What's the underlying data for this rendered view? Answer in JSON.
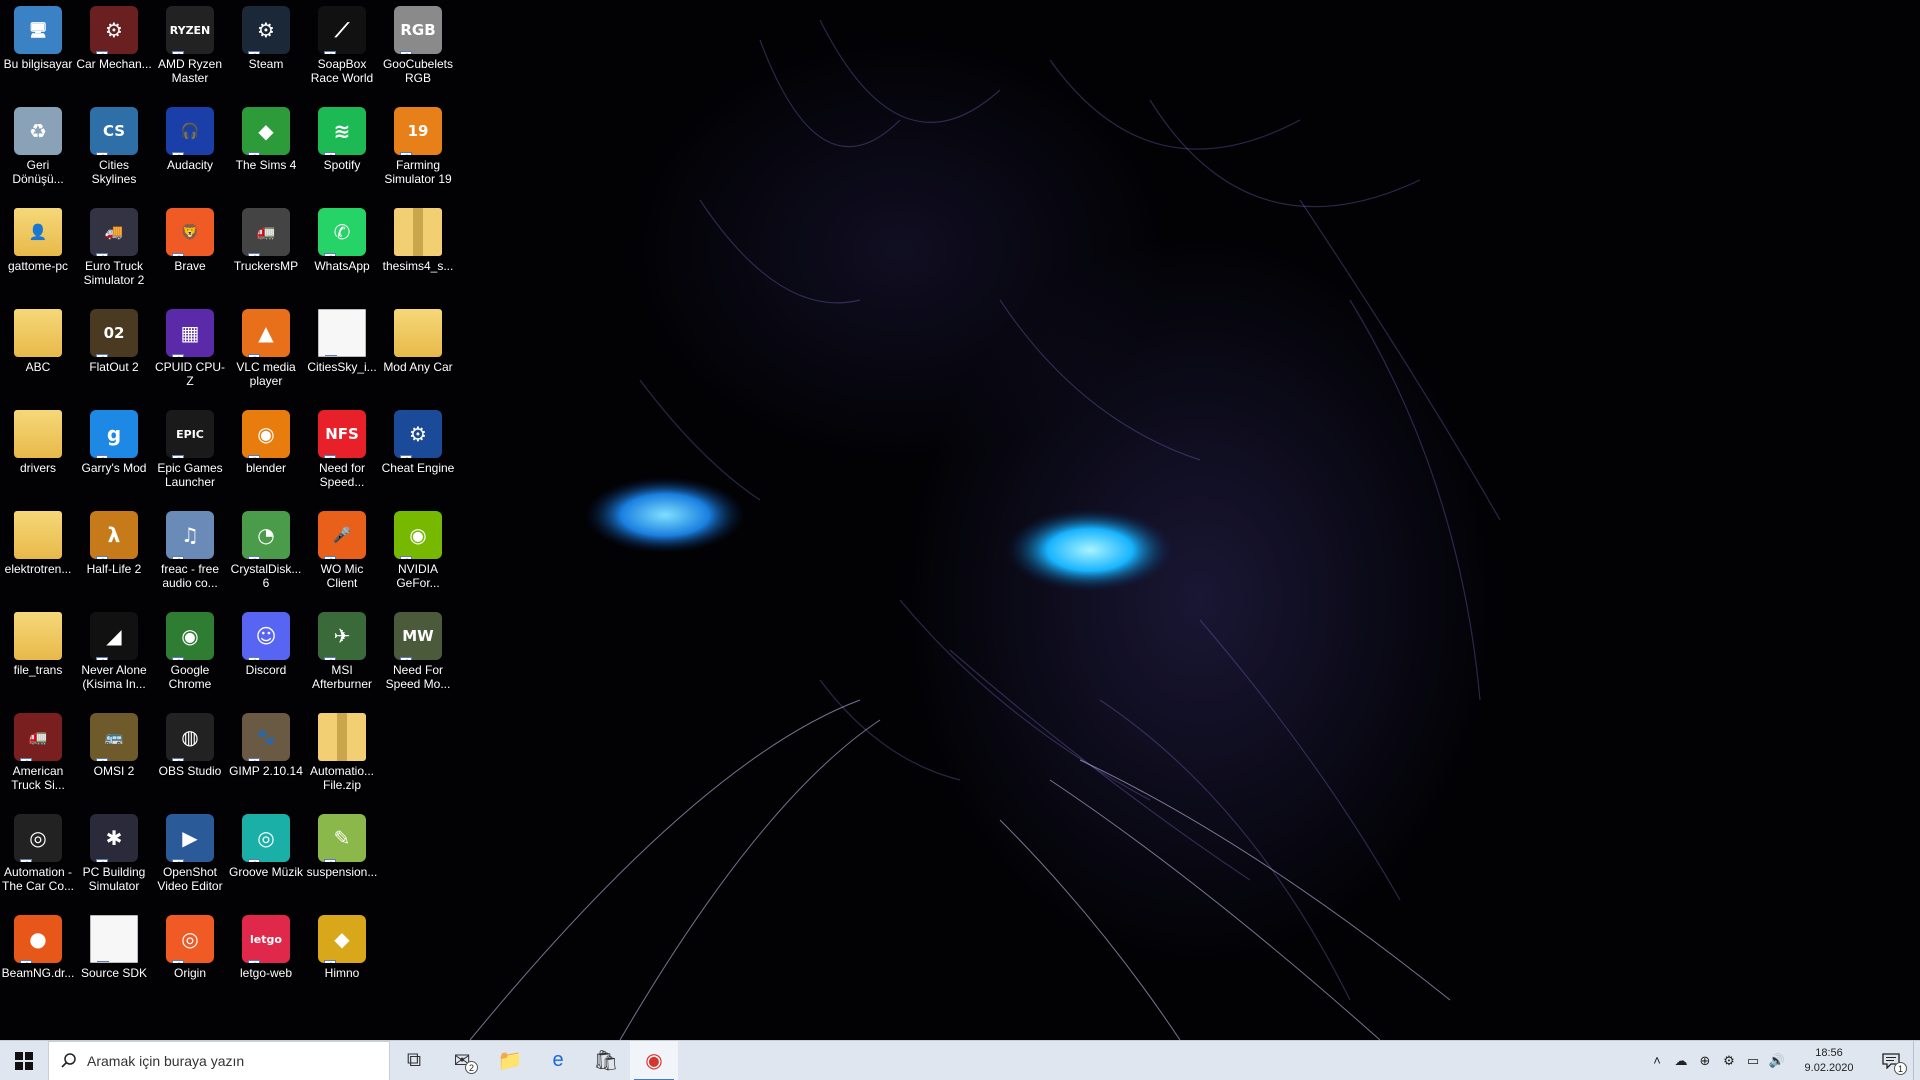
{
  "search": {
    "placeholder": "Aramak için buraya yazın"
  },
  "clock": {
    "time": "18:56",
    "date": "9.02.2020"
  },
  "mail_badge": "2",
  "notification_badge": "1",
  "desktop_icons": [
    {
      "label": "Bu bilgisayar",
      "icon": "computer-icon",
      "sym": "🖥",
      "bg": "#3b82c4"
    },
    {
      "label": "Geri Dönüşü...",
      "icon": "recycle-bin-icon",
      "sym": "♻",
      "bg": "#8aa2b8"
    },
    {
      "label": "gattome-pc",
      "icon": "user-folder-icon",
      "sym": "👤",
      "bg": "folder"
    },
    {
      "label": "ABC",
      "icon": "folder-icon",
      "sym": "",
      "bg": "folder"
    },
    {
      "label": "drivers",
      "icon": "folder-icon",
      "sym": "",
      "bg": "folder"
    },
    {
      "label": "elektrotren...",
      "icon": "folder-icon",
      "sym": "",
      "bg": "folder"
    },
    {
      "label": "file_trans",
      "icon": "folder-icon",
      "sym": "",
      "bg": "folder"
    },
    {
      "label": "American Truck Si...",
      "icon": "american-truck-icon",
      "sym": "🚛",
      "bg": "#7a1f1f"
    },
    {
      "label": "Automation - The Car Co...",
      "icon": "automation-icon",
      "sym": "◎",
      "bg": "#222"
    },
    {
      "label": "BeamNG.dr...",
      "icon": "beamng-icon",
      "sym": "●",
      "bg": "#e8571a"
    },
    {
      "label": "Car Mechan...",
      "icon": "car-mechanic-icon",
      "sym": "⚙",
      "bg": "#6a2020"
    },
    {
      "label": "Cities Skylines",
      "icon": "cities-skylines-icon",
      "sym": "CS",
      "bg": "#2f6fa8"
    },
    {
      "label": "Euro Truck Simulator 2",
      "icon": "euro-truck-icon",
      "sym": "🚚",
      "bg": "#334"
    },
    {
      "label": "FlatOut 2",
      "icon": "flatout-icon",
      "sym": "02",
      "bg": "#4a3a22"
    },
    {
      "label": "Garry's Mod",
      "icon": "garrys-mod-icon",
      "sym": "g",
      "bg": "#1e88e5"
    },
    {
      "label": "Half-Life 2",
      "icon": "half-life-icon",
      "sym": "λ",
      "bg": "#c77a1a"
    },
    {
      "label": "Never Alone (Kisima In...",
      "icon": "never-alone-icon",
      "sym": "◢",
      "bg": "#111"
    },
    {
      "label": "OMSI 2",
      "icon": "omsi-icon",
      "sym": "🚌",
      "bg": "#6e5a2a"
    },
    {
      "label": "PC Building Simulator",
      "icon": "pc-building-icon",
      "sym": "✱",
      "bg": "#2a2a3a"
    },
    {
      "label": "Source SDK",
      "icon": "document-icon",
      "sym": "",
      "bg": "doc"
    },
    {
      "label": "AMD Ryzen Master",
      "icon": "amd-ryzen-icon",
      "sym": "RYZEN",
      "bg": "#222"
    },
    {
      "label": "Audacity",
      "icon": "audacity-icon",
      "sym": "🎧",
      "bg": "#1a3fa8"
    },
    {
      "label": "Brave",
      "icon": "brave-icon",
      "sym": "🦁",
      "bg": "#f05a24"
    },
    {
      "label": "CPUID CPU-Z",
      "icon": "cpuz-icon",
      "sym": "▦",
      "bg": "#5a2aa8"
    },
    {
      "label": "Epic Games Launcher",
      "icon": "epic-games-icon",
      "sym": "EPIC",
      "bg": "#1a1a1a"
    },
    {
      "label": "freac - free audio co...",
      "icon": "freac-icon",
      "sym": "♫",
      "bg": "#6a8ab8"
    },
    {
      "label": "Google Chrome",
      "icon": "chrome-icon",
      "sym": "◉",
      "bg": "#2e7d32"
    },
    {
      "label": "OBS Studio",
      "icon": "obs-icon",
      "sym": "◍",
      "bg": "#222"
    },
    {
      "label": "OpenShot Video Editor",
      "icon": "openshot-icon",
      "sym": "▶",
      "bg": "#2a5a98"
    },
    {
      "label": "Origin",
      "icon": "origin-icon",
      "sym": "◎",
      "bg": "#f05a24"
    },
    {
      "label": "Steam",
      "icon": "steam-icon",
      "sym": "⚙",
      "bg": "#1b2838"
    },
    {
      "label": "The Sims 4",
      "icon": "sims-icon",
      "sym": "◆",
      "bg": "#2e9b3a"
    },
    {
      "label": "TruckersMP",
      "icon": "truckersmp-icon",
      "sym": "🚛",
      "bg": "#444"
    },
    {
      "label": "VLC media player",
      "icon": "vlc-icon",
      "sym": "▲",
      "bg": "#e8701a"
    },
    {
      "label": "blender",
      "icon": "blender-icon",
      "sym": "◉",
      "bg": "#e87d0d"
    },
    {
      "label": "CrystalDisk... 6",
      "icon": "crystaldisk-icon",
      "sym": "◔",
      "bg": "#4a9b4a"
    },
    {
      "label": "Discord",
      "icon": "discord-icon",
      "sym": "☺",
      "bg": "#5865f2"
    },
    {
      "label": "GIMP 2.10.14",
      "icon": "gimp-icon",
      "sym": "🐾",
      "bg": "#6a5a44"
    },
    {
      "label": "Groove Müzik",
      "icon": "groove-icon",
      "sym": "◎",
      "bg": "#1ab0a8"
    },
    {
      "label": "letgo-web",
      "icon": "letgo-icon",
      "sym": "letgo",
      "bg": "#e0284a"
    },
    {
      "label": "SoapBox Race World",
      "icon": "soapbox-icon",
      "sym": "⟋",
      "bg": "#111"
    },
    {
      "label": "Spotify",
      "icon": "spotify-icon",
      "sym": "≋",
      "bg": "#1db954"
    },
    {
      "label": "WhatsApp",
      "icon": "whatsapp-icon",
      "sym": "✆",
      "bg": "#25d366"
    },
    {
      "label": "CitiesSky_i...",
      "icon": "document-icon",
      "sym": "",
      "bg": "doc"
    },
    {
      "label": "Need for Speed...",
      "icon": "nfs-icon",
      "sym": "NFS",
      "bg": "#e8202a"
    },
    {
      "label": "WO Mic Client",
      "icon": "microphone-icon",
      "sym": "🎤",
      "bg": "#e8601a"
    },
    {
      "label": "MSI Afterburner",
      "icon": "msi-afterburner-icon",
      "sym": "✈",
      "bg": "#3a6a3a"
    },
    {
      "label": "Automatio... File.zip",
      "icon": "zip-folder-icon",
      "sym": "",
      "bg": "zip"
    },
    {
      "label": "suspension...",
      "icon": "suspension-icon",
      "sym": "✎",
      "bg": "#8ab84a"
    },
    {
      "label": "Himno",
      "icon": "himno-icon",
      "sym": "◆",
      "bg": "#d8a81a"
    },
    {
      "label": "GooCubelets RGB",
      "icon": "goocubelets-icon",
      "sym": "RGB",
      "bg": "#8a8a8a"
    },
    {
      "label": "Farming Simulator 19",
      "icon": "farming-sim-icon",
      "sym": "19",
      "bg": "#e8801a"
    },
    {
      "label": "thesims4_s...",
      "icon": "zip-folder-icon",
      "sym": "",
      "bg": "zip"
    },
    {
      "label": "Mod Any Car",
      "icon": "folder-icon",
      "sym": "",
      "bg": "folder"
    },
    {
      "label": "Cheat Engine",
      "icon": "cheat-engine-icon",
      "sym": "⚙",
      "bg": "#1a4a98"
    },
    {
      "label": "NVIDIA GeFor...",
      "icon": "nvidia-icon",
      "sym": "◉",
      "bg": "#76b900"
    },
    {
      "label": "Need For Speed Mo...",
      "icon": "nfs-mw-icon",
      "sym": "MW",
      "bg": "#4a5a3a"
    }
  ],
  "taskbar": {
    "apps": [
      {
        "name": "task-view-button",
        "icon": "task-view-icon",
        "sym": "⧉"
      },
      {
        "name": "mail-button",
        "icon": "mail-icon",
        "sym": "✉",
        "badge": true
      },
      {
        "name": "file-explorer-button",
        "icon": "folder-icon",
        "sym": "📁"
      },
      {
        "name": "edge-button",
        "icon": "edge-icon",
        "sym": "e"
      },
      {
        "name": "store-button",
        "icon": "store-icon",
        "sym": "🛍"
      },
      {
        "name": "chrome-taskbar-button",
        "icon": "chrome-icon",
        "sym": "◉",
        "active": true
      }
    ],
    "tray": [
      {
        "name": "tray-expand",
        "icon": "chevron-up-icon",
        "sym": "˄"
      },
      {
        "name": "tray-onedrive",
        "icon": "cloud-icon",
        "sym": "☁"
      },
      {
        "name": "tray-app",
        "icon": "game-icon",
        "sym": "⊕"
      },
      {
        "name": "tray-steam",
        "icon": "steam-icon",
        "sym": "⚙"
      },
      {
        "name": "tray-network",
        "icon": "network-icon",
        "sym": "▭"
      },
      {
        "name": "tray-volume",
        "icon": "volume-icon",
        "sym": "🔊"
      }
    ]
  }
}
